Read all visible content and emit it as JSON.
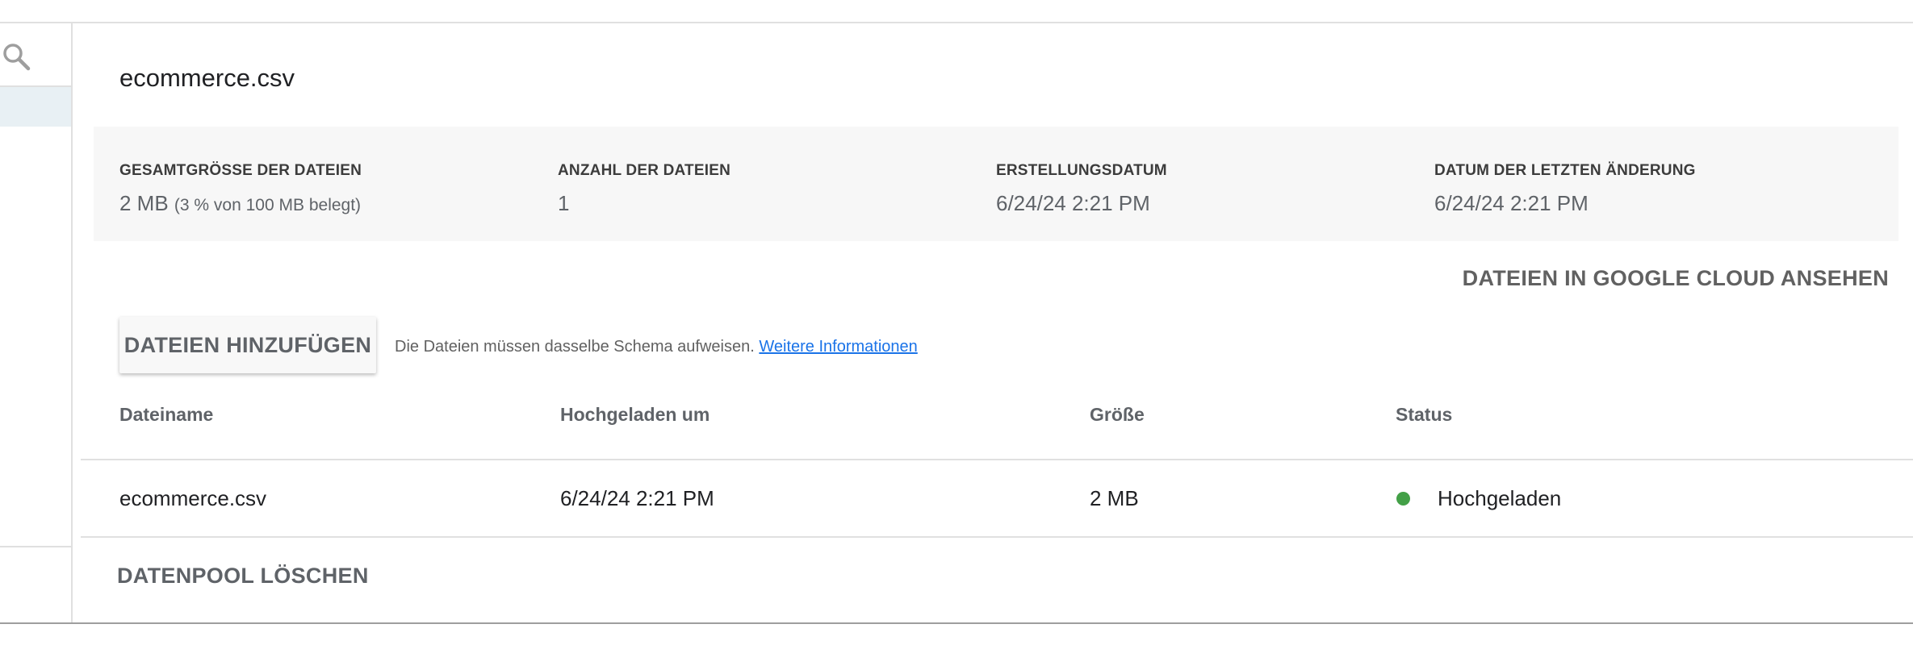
{
  "pool": {
    "title": "ecommerce.csv"
  },
  "stats": [
    {
      "label": "GESAMTGRÖSSE DER DATEIEN",
      "value": "2 MB",
      "sub": "(3 % von 100 MB belegt)"
    },
    {
      "label": "ANZAHL DER DATEIEN",
      "value": "1",
      "sub": ""
    },
    {
      "label": "ERSTELLUNGSDATUM",
      "value": "6/24/24 2:21 PM",
      "sub": ""
    },
    {
      "label": "DATUM DER LETZTEN ÄNDERUNG",
      "value": "6/24/24 2:21 PM",
      "sub": ""
    }
  ],
  "actions": {
    "view_cloud": "DATEIEN IN GOOGLE CLOUD ANSEHEN",
    "add_files": "DATEIEN HINZUFÜGEN",
    "schema_note": "Die Dateien müssen dasselbe Schema aufweisen.",
    "schema_link": "Weitere Informationen",
    "delete_pool": "DATENPOOL LÖSCHEN"
  },
  "table": {
    "headers": [
      "Dateiname",
      "Hochgeladen um",
      "Größe",
      "Status"
    ],
    "rows": [
      {
        "filename": "ecommerce.csv",
        "uploaded": "6/24/24 2:21 PM",
        "size": "2 MB",
        "status": "Hochgeladen",
        "status_color": "#43a047"
      }
    ]
  },
  "icons": {
    "sidebar_search": "search-icon"
  }
}
